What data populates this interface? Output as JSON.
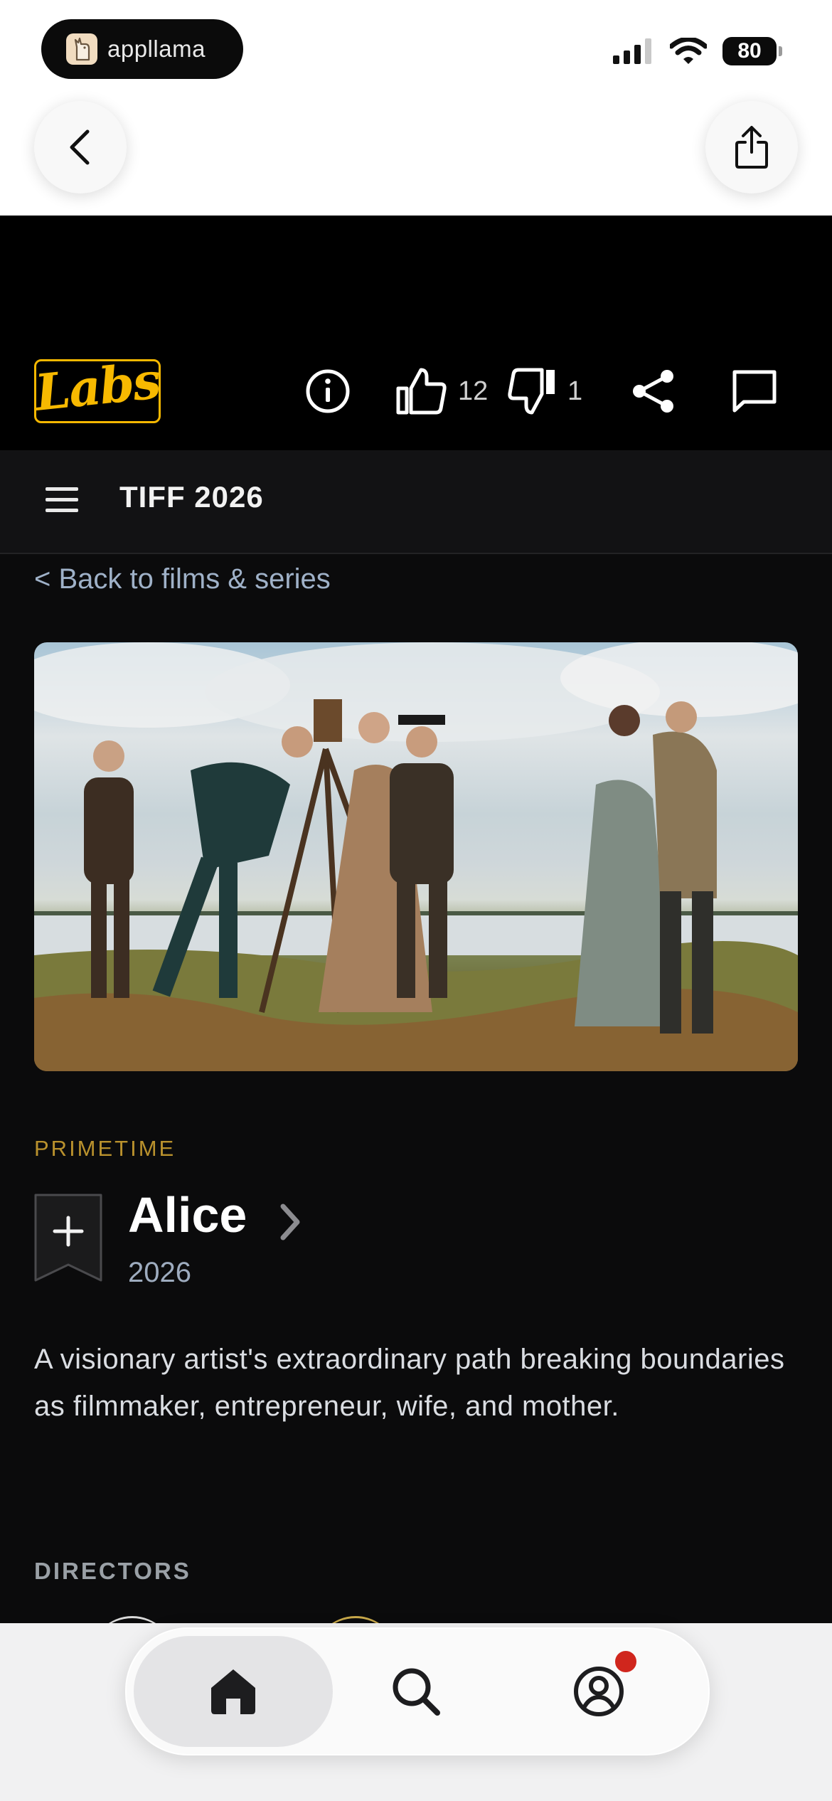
{
  "status_bar": {
    "app_name": "appllama",
    "battery": "80"
  },
  "browser": {
    "back_icon": "chevron-left-icon",
    "share_icon": "share-upload-icon"
  },
  "header": {
    "logo_text": "Labs",
    "likes": "12",
    "dislikes": "1",
    "accent_color": "#f5b700"
  },
  "subnav": {
    "title": "TIFF 2026"
  },
  "main": {
    "back_link": "< Back to films & series",
    "category": "PRIMETIME",
    "title": "Alice",
    "year": "2026",
    "synopsis": "A visionary artist's extraordinary path breaking boundaries as filmmaker, entrepreneur, wife, and mother.",
    "directors_label": "DIRECTORS"
  },
  "tabbar": {
    "tabs": [
      "home-icon",
      "search-icon",
      "profile-icon"
    ],
    "notification_color": "#d0261d"
  }
}
